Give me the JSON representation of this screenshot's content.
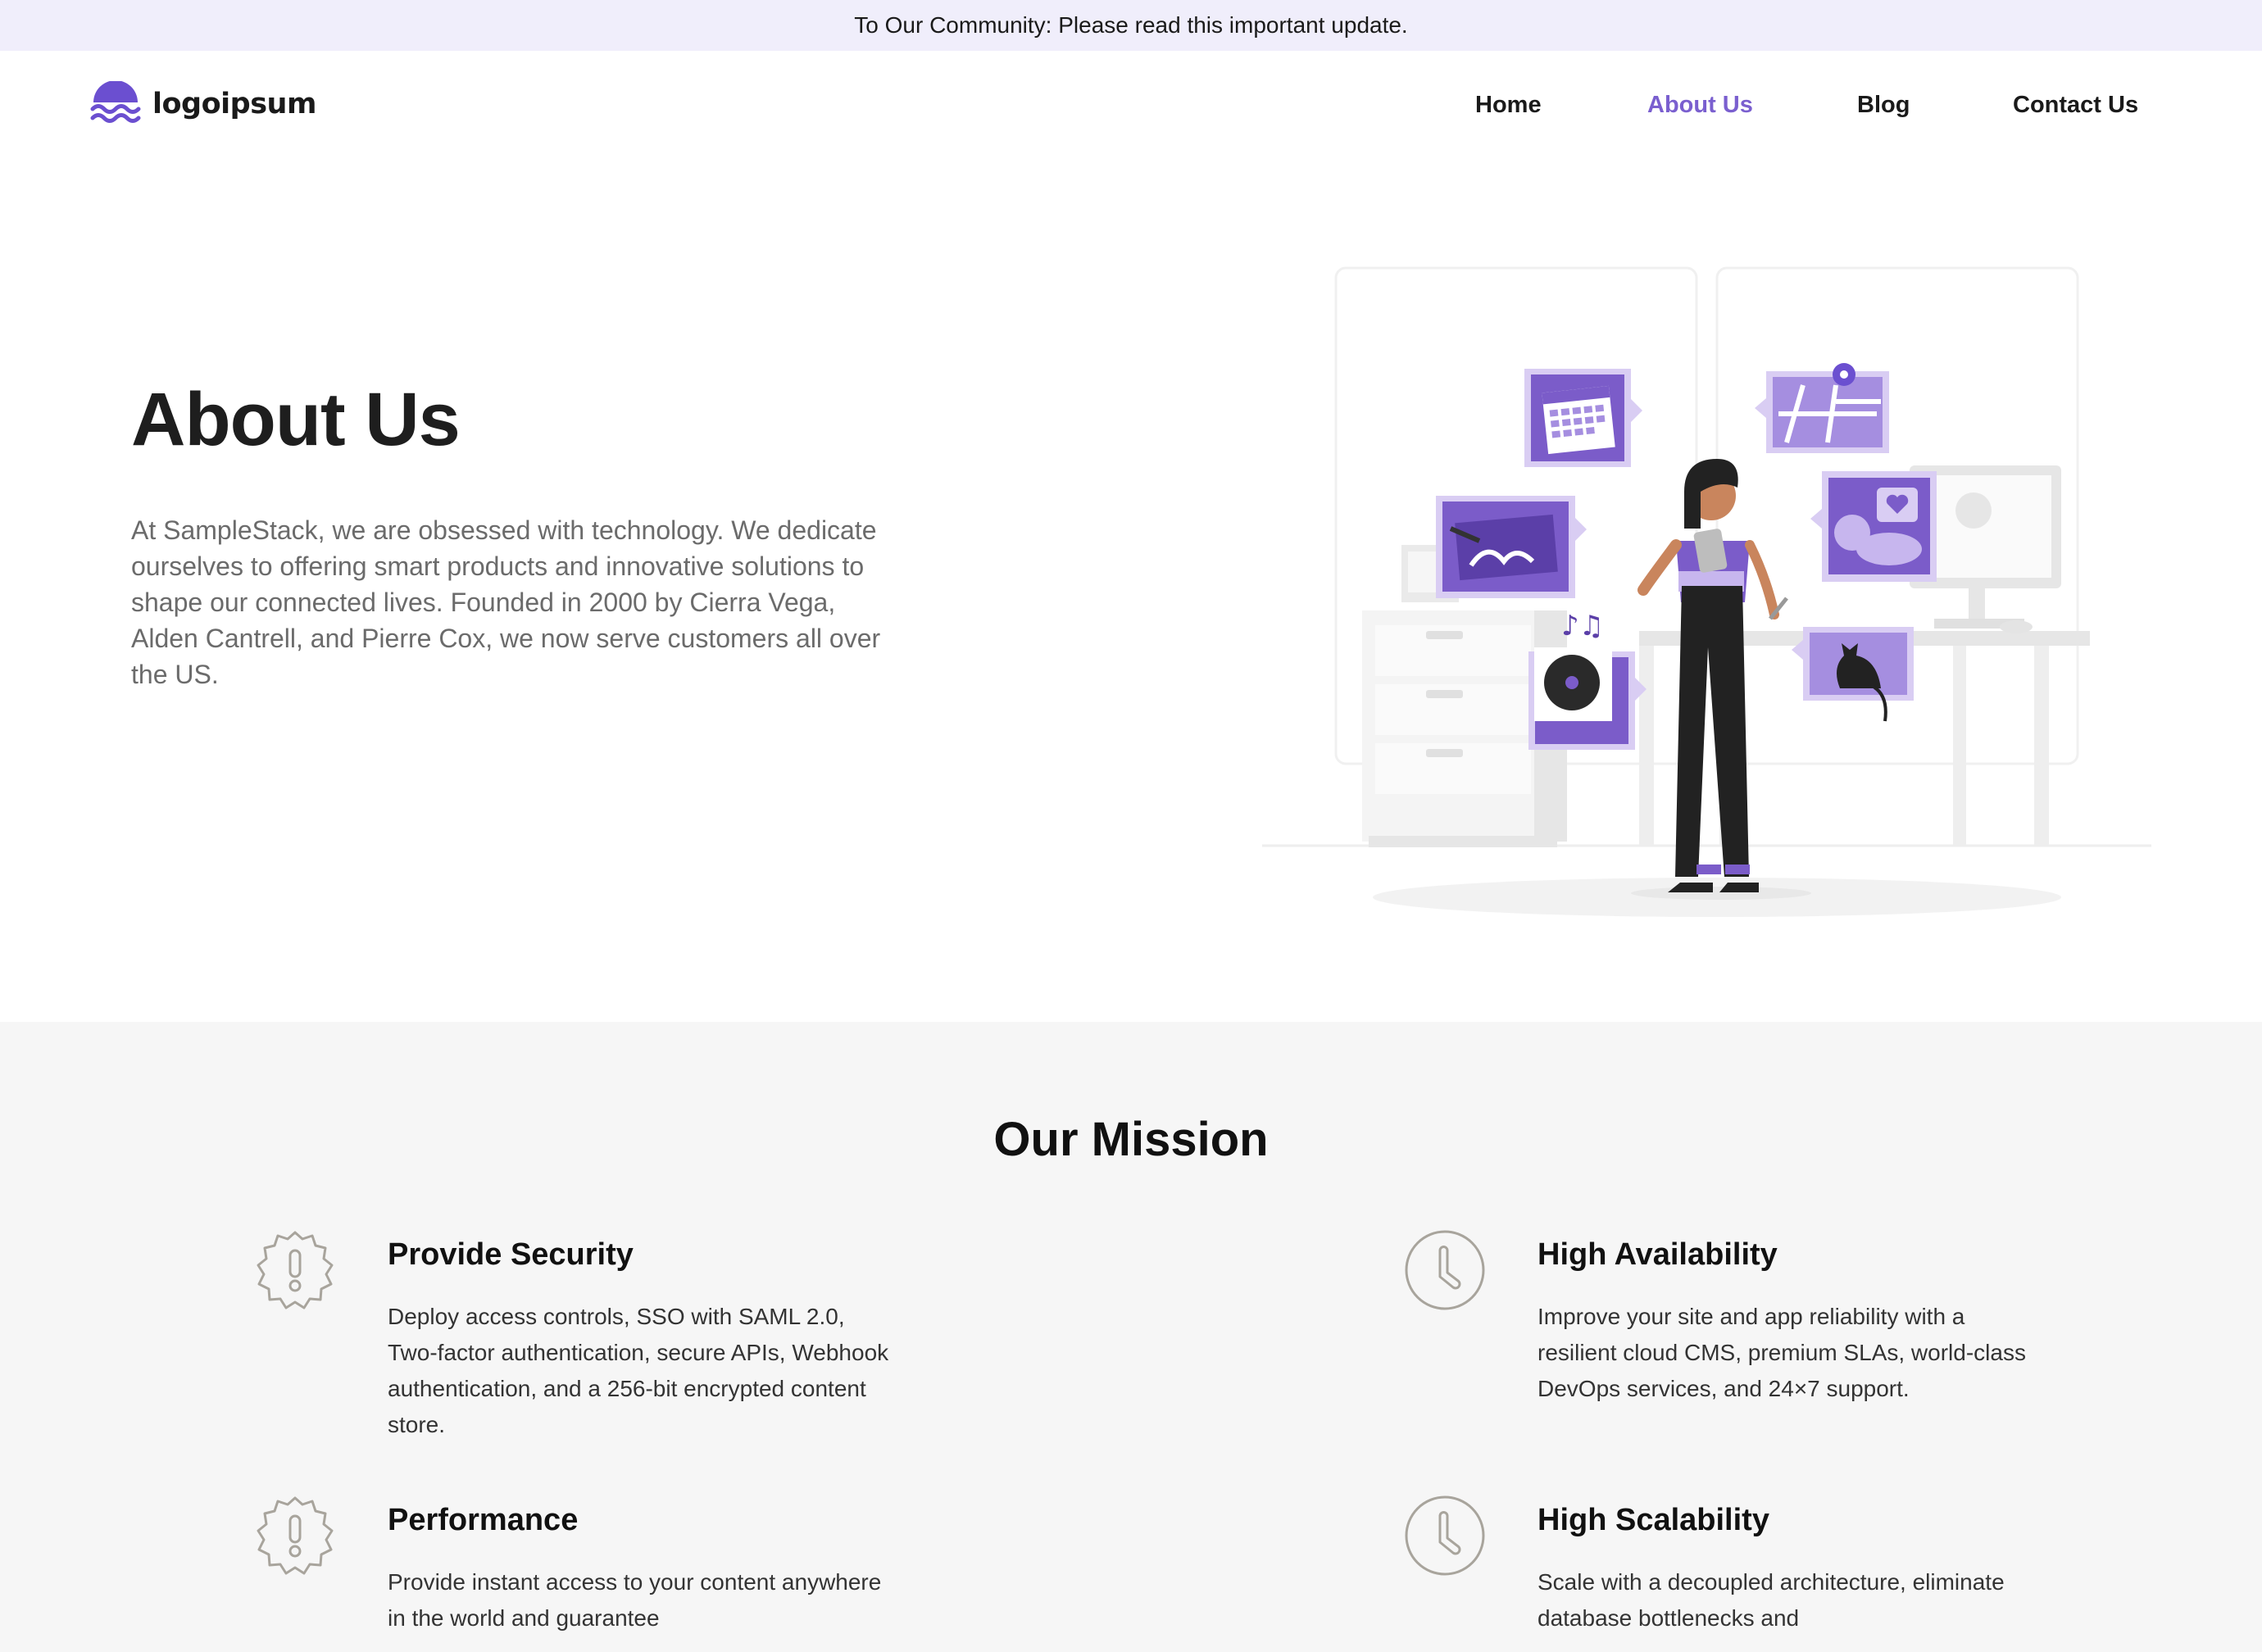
{
  "banner": {
    "text": "To Our Community: Please read this important update."
  },
  "header": {
    "logo_text": "logoipsum",
    "nav": [
      {
        "label": "Home",
        "active": false
      },
      {
        "label": "About Us",
        "active": true
      },
      {
        "label": "Blog",
        "active": false
      },
      {
        "label": "Contact Us",
        "active": false
      }
    ]
  },
  "hero": {
    "title": "About Us",
    "text": "At SampleStack, we are obsessed with technology. We dedicate ourselves to offering smart products and innovative solutions to shape our connected lives. Founded in 2000 by Cierra Vega, Alden Cantrell, and Pierre Cox, we now serve customers all over the US."
  },
  "mission": {
    "title": "Our Mission",
    "features": [
      {
        "icon": "badge-alert-icon",
        "title": "Provide Security",
        "text": "Deploy access controls, SSO with SAML 2.0, Two-factor authentication, secure APIs, Webhook authentication, and a 256-bit encrypted content store."
      },
      {
        "icon": "clock-icon",
        "title": "High Availability",
        "text": "Improve your site and app reliability with a resilient cloud CMS, premium SLAs, world-class DevOps services, and 24×7 support."
      },
      {
        "icon": "badge-alert-icon",
        "title": "Performance",
        "text": "Provide instant access to your content anywhere in the world and guarantee"
      },
      {
        "icon": "clock-icon",
        "title": "High Scalability",
        "text": "Scale with a decoupled architecture, eliminate database bottlenecks and"
      }
    ]
  },
  "colors": {
    "accent": "#7a5fcf",
    "banner_bg": "#f0eefb",
    "mission_bg": "#f6f6f6",
    "icon_stroke": "#a8a49c"
  }
}
